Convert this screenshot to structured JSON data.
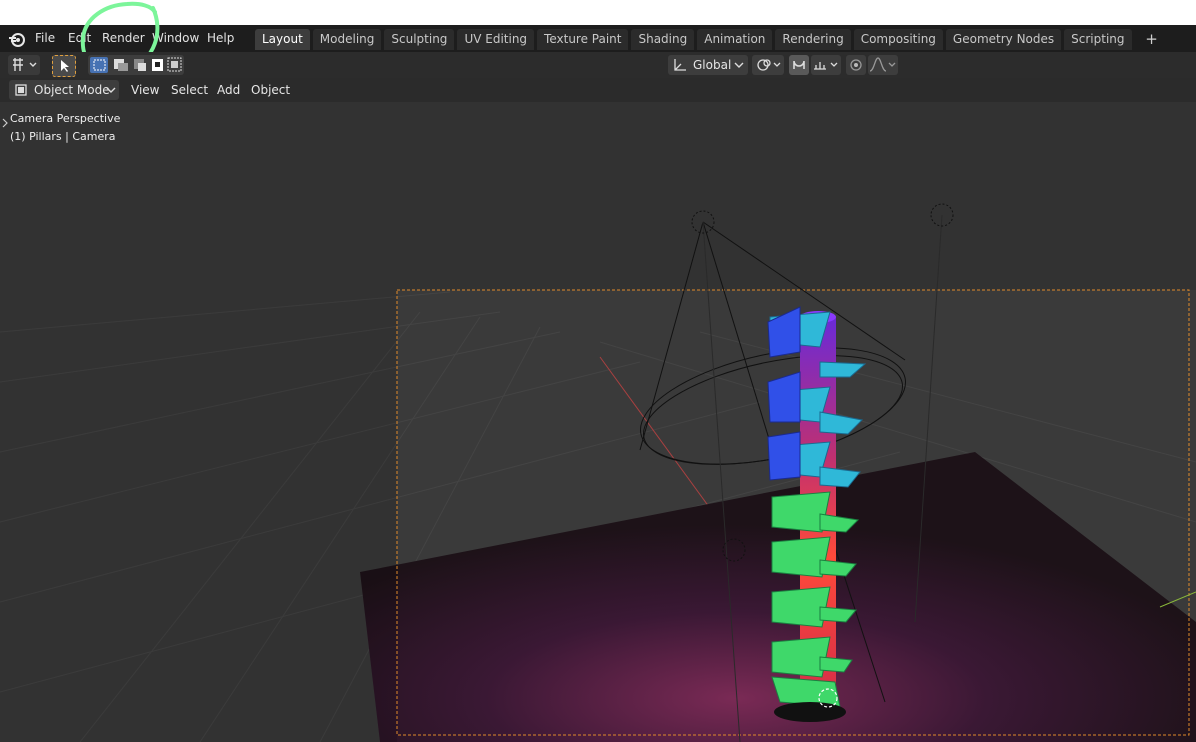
{
  "menubar": {
    "items": [
      {
        "label": "File"
      },
      {
        "label": "Edit"
      },
      {
        "label": "Render"
      },
      {
        "label": "Window"
      },
      {
        "label": "Help"
      }
    ],
    "logo_icon": "blender-logo-icon"
  },
  "workspace_tabs": [
    {
      "label": "Layout",
      "active": true
    },
    {
      "label": "Modeling"
    },
    {
      "label": "Sculpting"
    },
    {
      "label": "UV Editing"
    },
    {
      "label": "Texture Paint"
    },
    {
      "label": "Shading"
    },
    {
      "label": "Animation"
    },
    {
      "label": "Rendering"
    },
    {
      "label": "Compositing"
    },
    {
      "label": "Geometry Nodes"
    },
    {
      "label": "Scripting"
    }
  ],
  "add_tab_symbol": "+",
  "toolbar": {
    "transform_orientation": "Global"
  },
  "viewport_header": {
    "mode": "Object Mode",
    "menus": [
      "View",
      "Select",
      "Add",
      "Object"
    ]
  },
  "viewport_overlay": {
    "perspective": "Camera Perspective",
    "active_object": "(1) Pillars | Camera"
  },
  "annotation": {
    "color": "#7cf59a",
    "target": "Render menu"
  },
  "colors": {
    "camera_frame": "#e08a2a",
    "viewport_bg": "#3a3a3a",
    "header_bg": "#2b2b2b"
  }
}
